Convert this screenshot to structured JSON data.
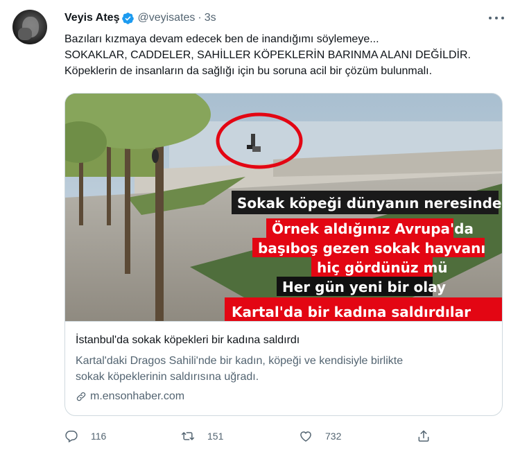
{
  "tweet": {
    "author": {
      "name": "Veyis Ateş",
      "handle": "@veyisates",
      "separator": "·",
      "time": "3s",
      "verified": true
    },
    "text_lines": [
      "Bazıları kızmaya devam edecek ben de inandığımı söylemeye...",
      "SOKAKLAR, CADDELER, SAHİLLER KÖPEKLERİN BARINMA ALANI DEĞİLDİR.",
      "Köpeklerin de insanların da sağlığı için bu soruna acil bir çözüm bulunmalı."
    ]
  },
  "card": {
    "overlay_lines": [
      "Sokak köpeği dünyanın neresinde var",
      "Örnek aldığınız Avrupa'da",
      "başıboş gezen sokak hayvanı",
      "hiç gördünüz mü",
      "Her gün yeni bir olay",
      "Kartal'da bir kadına saldırdılar"
    ],
    "title": "İstanbul'da sokak köpekleri bir kadına saldırdı",
    "description_lines": [
      "Kartal'daki Dragos Sahili'nde bir kadın, köpeği ve kendisiyle birlikte",
      "sokak köpeklerinin saldırısına uğradı."
    ],
    "domain": "m.ensonhaber.com"
  },
  "actions": {
    "reply_count": "116",
    "retweet_count": "151",
    "like_count": "732"
  },
  "icons": {
    "verified": "verified-badge-icon",
    "more": "more-horizontal-icon",
    "link": "link-icon",
    "reply": "reply-icon",
    "retweet": "retweet-icon",
    "like": "heart-icon",
    "share": "share-icon"
  },
  "colors": {
    "accent": "#1d9bf0",
    "text": "#0f1419",
    "secondary": "#536471",
    "overlay_red": "#e30613",
    "overlay_dark": "#1a1a1a"
  }
}
